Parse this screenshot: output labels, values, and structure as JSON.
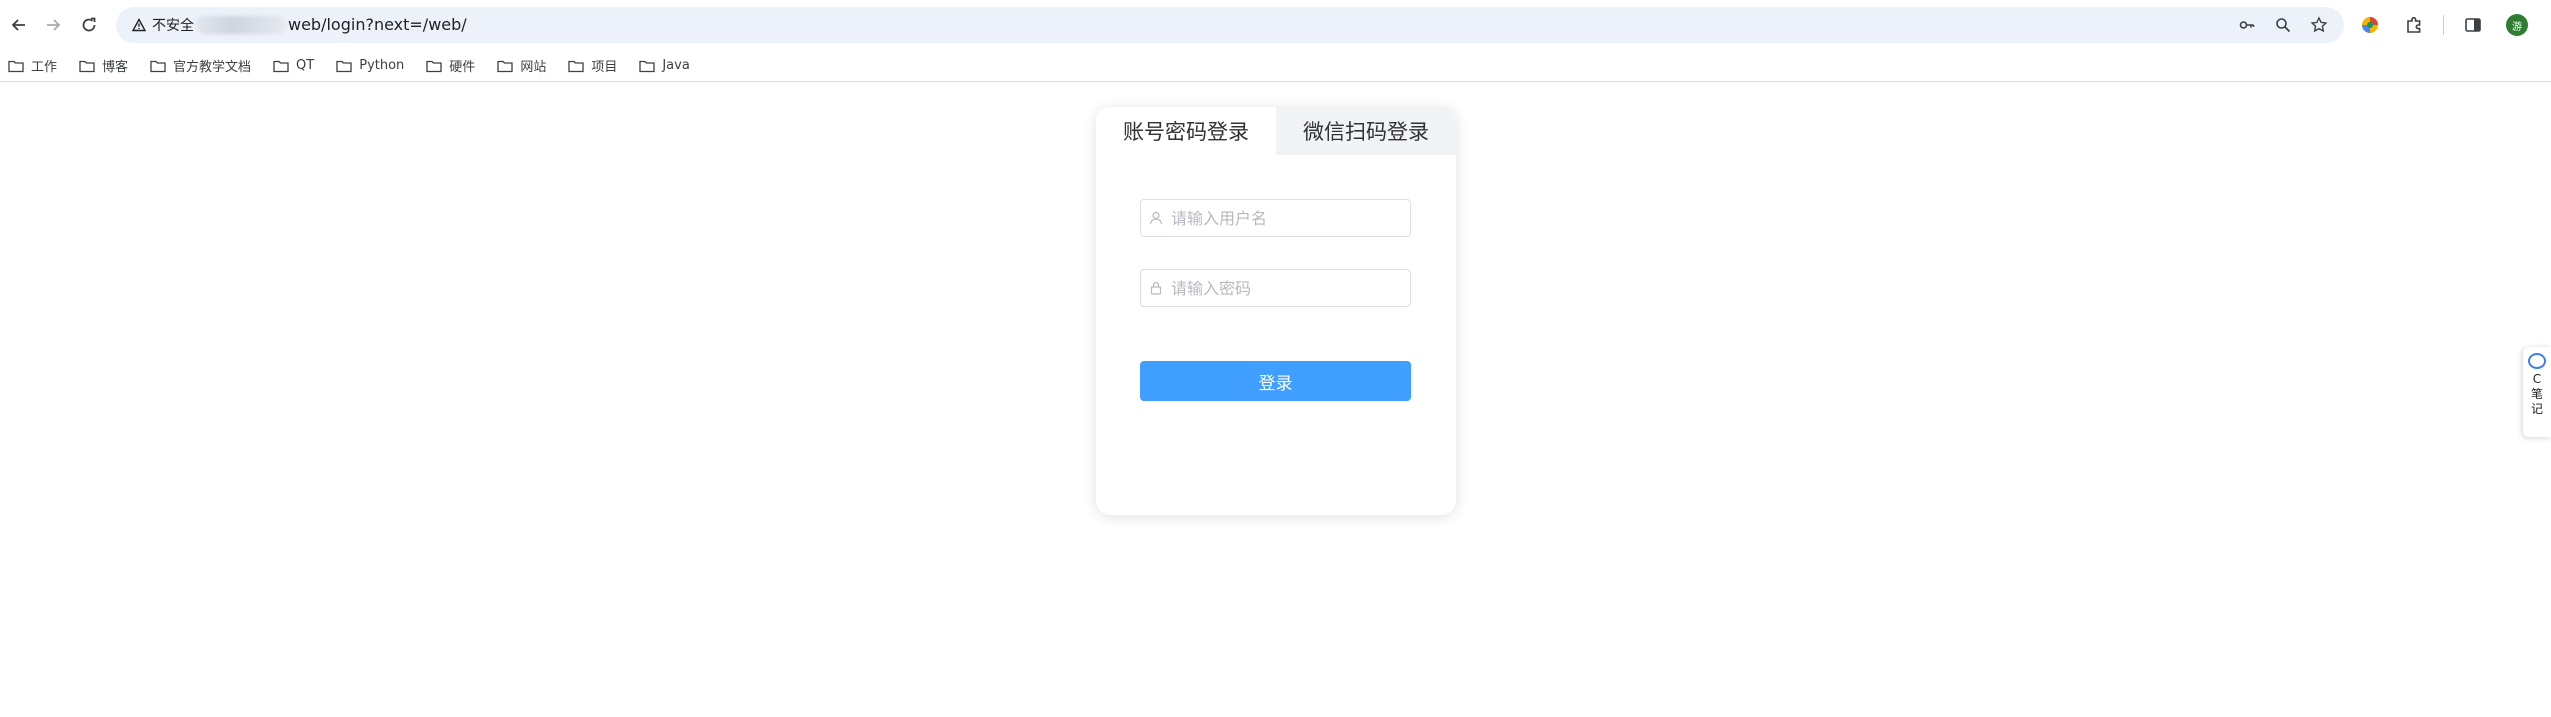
{
  "browser": {
    "security_label": "不安全",
    "url": "web/login?next=/web/",
    "avatar_letter": "游"
  },
  "bookmarks": [
    {
      "label": "工作",
      "icon": "folder-icon"
    },
    {
      "label": "博客",
      "icon": "folder-icon"
    },
    {
      "label": "官方教学文档",
      "icon": "folder-icon"
    },
    {
      "label": "QT",
      "icon": "folder-icon"
    },
    {
      "label": "Python",
      "icon": "folder-icon"
    },
    {
      "label": "硬件",
      "icon": "folder-icon"
    },
    {
      "label": "网站",
      "icon": "folder-icon"
    },
    {
      "label": "项目",
      "icon": "folder-icon"
    },
    {
      "label": "Java",
      "icon": "folder-icon"
    }
  ],
  "login": {
    "tabs": [
      {
        "label": "账号密码登录",
        "active": true
      },
      {
        "label": "微信扫码登录",
        "active": false
      }
    ],
    "username_placeholder": "请输入用户名",
    "password_placeholder": "请输入密码",
    "submit_label": "登录"
  },
  "side_widget": {
    "lines": [
      "C",
      "笔",
      "记"
    ]
  },
  "colors": {
    "primary": "#409eff",
    "omnibox_bg": "#edf1fa",
    "tab_inactive_bg": "#f2f3f5"
  }
}
